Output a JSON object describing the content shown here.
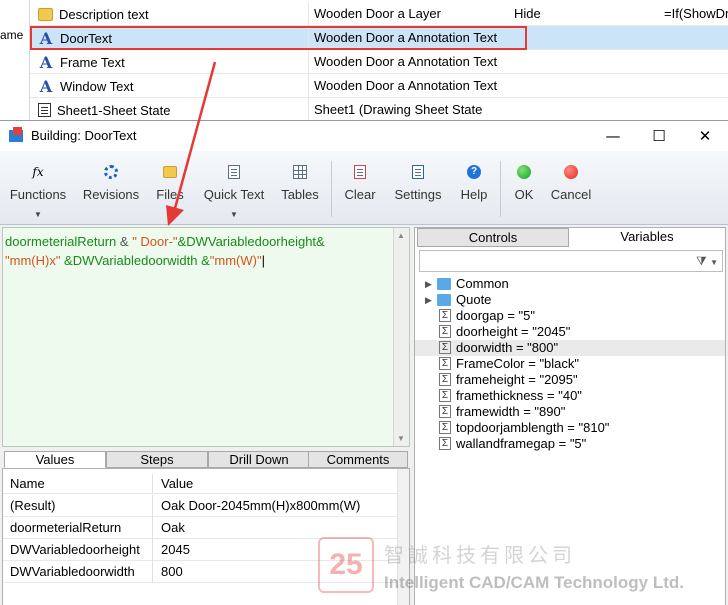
{
  "background": {
    "side_label": "ame",
    "rows": [
      {
        "icon": "folder-icon",
        "name": "Description text",
        "type": "Wooden Door a Layer",
        "extra": "Hide",
        "formula": "=If(ShowDr"
      },
      {
        "icon": "text-style-icon",
        "name": "DoorText",
        "type": "Wooden Door a Annotation Text",
        "extra": "",
        "formula": ""
      },
      {
        "icon": "text-style-icon",
        "name": "Frame Text",
        "type": "Wooden Door a Annotation Text",
        "extra": "",
        "formula": ""
      },
      {
        "icon": "text-style-icon",
        "name": "Window Text",
        "type": "Wooden Door a Annotation Text",
        "extra": "",
        "formula": ""
      },
      {
        "icon": "sheet-icon",
        "name": "Sheet1-Sheet State",
        "type": "Sheet1 (Drawing Sheet State",
        "extra": "",
        "formula": ""
      }
    ]
  },
  "dialog": {
    "title": "Building: DoorText",
    "window_controls": {
      "minimize": "—",
      "maximize": "☐",
      "close": "✕"
    }
  },
  "toolbar": {
    "functions": "Functions",
    "functions_icon": "fx",
    "revisions": "Revisions",
    "files": "Files",
    "quick_text": "Quick Text",
    "tables": "Tables",
    "clear": "Clear",
    "settings": "Settings",
    "help": "Help",
    "help_icon": "?",
    "ok": "OK",
    "cancel": "Cancel",
    "dropdown_arrow": "▼"
  },
  "editor": {
    "t1": "doormeterialReturn",
    "t2": " & ",
    "t3": "\" Door-\"",
    "t4": "&DWVariabledoorheight&",
    "t5": "\"mm(H)x\"",
    "t6": " &DWVariabledoorwidth &",
    "t7": "\"mm(W)\"",
    "t8": "|",
    "scroll_up": "▲",
    "scroll_down": "▼"
  },
  "right_panel": {
    "tabs": {
      "controls": "Controls",
      "variables": "Variables"
    },
    "filter_icon": "▼",
    "tree": [
      {
        "kind": "folder",
        "label": "Common",
        "expander": "▶"
      },
      {
        "kind": "folder",
        "label": "Quote",
        "expander": "▶"
      },
      {
        "kind": "var",
        "label": "doorgap = \"5\""
      },
      {
        "kind": "var",
        "label": "doorheight = \"2045\""
      },
      {
        "kind": "var",
        "label": "doorwidth = \"800\""
      },
      {
        "kind": "var",
        "label": "FrameColor = \"black\""
      },
      {
        "kind": "var",
        "label": "frameheight = \"2095\""
      },
      {
        "kind": "var",
        "label": "framethickness = \"40\""
      },
      {
        "kind": "var",
        "label": "framewidth = \"890\""
      },
      {
        "kind": "var",
        "label": "topdoorjamblength = \"810\""
      },
      {
        "kind": "var",
        "label": "wallandframegap = \"5\""
      }
    ],
    "sigma": "Σ"
  },
  "bottom_tabs": {
    "values": "Values",
    "steps": "Steps",
    "drill_down": "Drill Down",
    "comments": "Comments"
  },
  "values_grid": {
    "header": {
      "name": "Name",
      "value": "Value"
    },
    "rows": [
      {
        "name": "(Result)",
        "value": "Oak Door-2045mm(H)x800mm(W)"
      },
      {
        "name": "doormeterialReturn",
        "value": "Oak"
      },
      {
        "name": "DWVariabledoorheight",
        "value": "2045"
      },
      {
        "name": "DWVariabledoorwidth",
        "value": "800"
      }
    ]
  },
  "watermark": {
    "logo": "25",
    "chinese": "智誠科技有限公司",
    "english": "Intelligent CAD/CAM Technology Ltd."
  },
  "colors": {
    "highlight_box": "#e53935",
    "selected_row": "#cce4f7",
    "editor_bg": "#eefaee"
  }
}
